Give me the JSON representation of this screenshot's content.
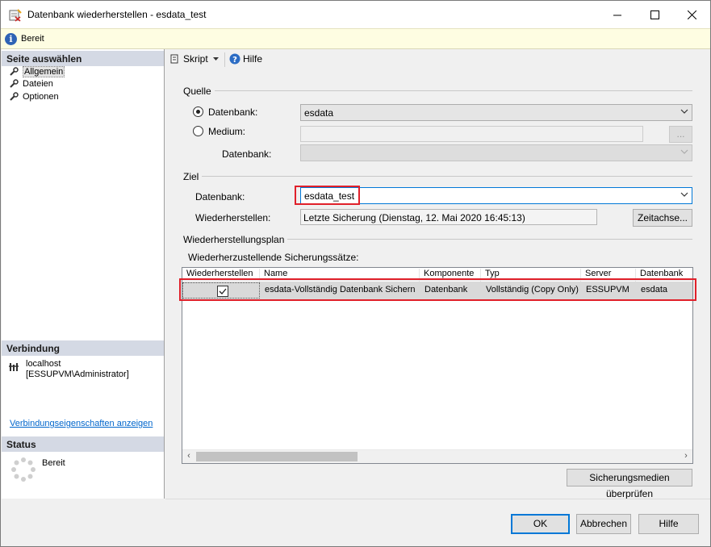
{
  "window": {
    "title": "Datenbank wiederherstellen - esdata_test"
  },
  "status_bar": {
    "text": "Bereit"
  },
  "left": {
    "select_page_header": "Seite auswählen",
    "pages": [
      {
        "label": "Allgemein",
        "selected": true
      },
      {
        "label": "Dateien",
        "selected": false
      },
      {
        "label": "Optionen",
        "selected": false
      }
    ],
    "connection_header": "Verbindung",
    "server": "localhost",
    "user": "[ESSUPVM\\Administrator]",
    "connection_link": "Verbindungseigenschaften anzeigen",
    "status_header": "Status",
    "status_text": "Bereit"
  },
  "toolbar": {
    "script_label": "Skript",
    "help_label": "Hilfe"
  },
  "source": {
    "group_label": "Quelle",
    "database_radio": "Datenbank:",
    "database_value": "esdata",
    "device_radio": "Medium:",
    "device_db_label": "Datenbank:",
    "browse_label": "..."
  },
  "target": {
    "group_label": "Ziel",
    "database_label": "Datenbank:",
    "database_value": "esdata_test",
    "restore_to_label": "Wiederherstellen:",
    "restore_to_value": "Letzte Sicherung (Dienstag, 12. Mai 2020 16:45:13)",
    "timeline_label": "Zeitachse..."
  },
  "plan": {
    "group_label": "Wiederherstellungsplan",
    "sets_label": "Wiederherzustellende Sicherungssätze:",
    "columns": [
      "Wiederherstellen",
      "Name",
      "Komponente",
      "Typ",
      "Server",
      "Datenbank"
    ],
    "rows": [
      {
        "restore": true,
        "name": "esdata-Vollständig Datenbank Sichern",
        "component": "Datenbank",
        "type": "Vollständig (Copy Only)",
        "server": "ESSUPVM",
        "database": "esdata"
      }
    ],
    "verify_label": "Sicherungsmedien überprüfen"
  },
  "footer": {
    "ok_label": "OK",
    "cancel_label": "Abbrechen",
    "help_label": "Hilfe"
  },
  "colors": {
    "highlight_red": "#e0202a",
    "accent_blue": "#0078d7",
    "section_header": "#d4d9e4"
  }
}
